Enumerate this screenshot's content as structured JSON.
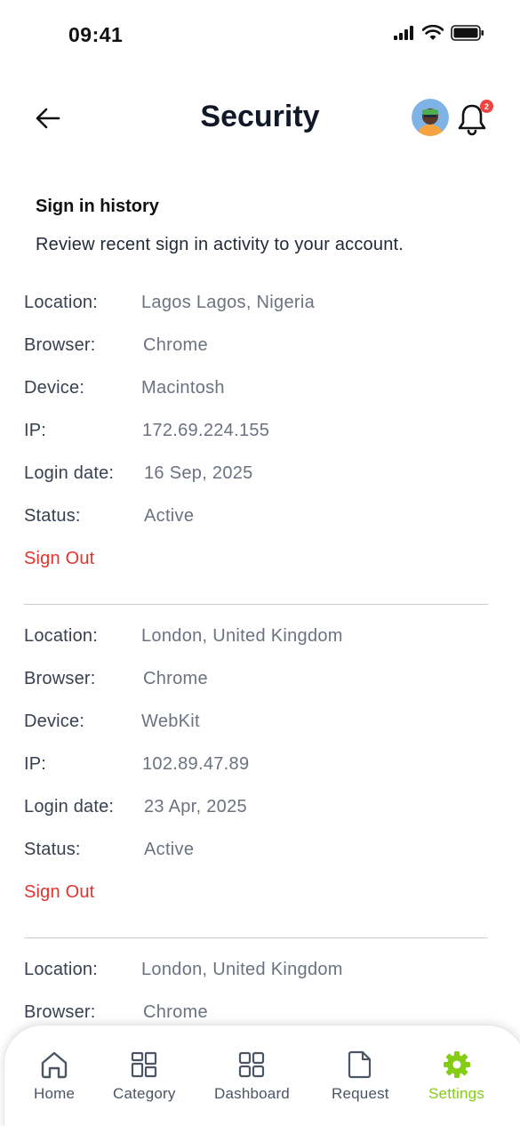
{
  "status_bar": {
    "time": "09:41"
  },
  "header": {
    "title": "Security",
    "notification_count": "2",
    "icons": [
      "back-arrow-icon",
      "avatar",
      "bell-icon"
    ]
  },
  "section": {
    "heading": "Sign in history",
    "description": "Review recent sign in activity to your account."
  },
  "labels": {
    "location": "Location:",
    "browser": "Browser:",
    "device": "Device:",
    "ip": "IP:",
    "login_date": "Login date:",
    "status": "Status:",
    "sign_out": "Sign Out"
  },
  "sessions": [
    {
      "location": "Lagos Lagos, Nigeria",
      "browser": "Chrome",
      "device": "Macintosh",
      "ip": "172.69.224.155",
      "login_date": "16 Sep, 2025",
      "status": "Active"
    },
    {
      "location": "London, United Kingdom",
      "browser": "Chrome",
      "device": "WebKit",
      "ip": "102.89.47.89",
      "login_date": "23 Apr, 2025",
      "status": "Active"
    },
    {
      "location": "London, United Kingdom",
      "browser": "Chrome"
    }
  ],
  "nav": {
    "items": [
      {
        "label": "Home",
        "icon": "home-icon"
      },
      {
        "label": "Category",
        "icon": "category-icon"
      },
      {
        "label": "Dashboard",
        "icon": "dashboard-icon"
      },
      {
        "label": "Request",
        "icon": "document-icon"
      },
      {
        "label": "Settings",
        "icon": "gear-icon"
      }
    ],
    "active": "Settings"
  },
  "colors": {
    "accent": "#84cc16",
    "danger": "#e5322d",
    "badge": "#ef4444",
    "text_primary": "#111827",
    "text_muted": "#6b7280"
  }
}
